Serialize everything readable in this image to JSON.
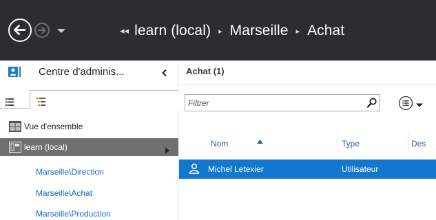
{
  "window": {
    "breadcrumb": [
      "learn (local)",
      "Marseille",
      "Achat"
    ]
  },
  "nav": {
    "title": "Centre d'adminis...",
    "items": [
      {
        "label": "Vue d'ensemble"
      },
      {
        "label": "learn (local)"
      }
    ],
    "sub_items": [
      {
        "label": "Marseille\\Direction"
      },
      {
        "label": "Marseille\\Achat"
      },
      {
        "label": "Marseille\\Production"
      }
    ]
  },
  "main": {
    "title": "Achat  (1)",
    "filter": {
      "placeholder": "Filtrer",
      "value": ""
    },
    "columns": [
      "Nom",
      "Type",
      "Des"
    ],
    "rows": [
      {
        "name": "Michel Letexier",
        "type": "Utilisateur",
        "selected": true
      }
    ]
  },
  "colors": {
    "titlebar": "#2d2d30",
    "accent": "#1979ca",
    "selection": "#1278cf",
    "link": "#1c69c1",
    "nav_selected": "#707070"
  },
  "icons": {
    "back": "back-arrow-icon",
    "forward": "forward-arrow-icon",
    "search": "search-icon",
    "options": "list-options-icon",
    "user": "user-icon"
  }
}
